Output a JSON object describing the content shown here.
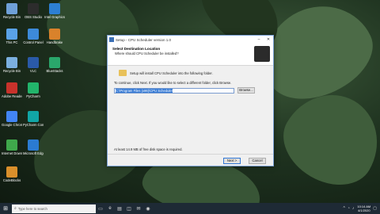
{
  "desktop_icons": [
    {
      "label": "Recycle Bin",
      "color": "#6fa0d8"
    },
    {
      "label": "OBS Studio",
      "color": "#2c2c2c"
    },
    {
      "label": "Intel Graphics",
      "color": "#2d7fd3"
    },
    {
      "label": "This PC",
      "color": "#5aa3e8"
    },
    {
      "label": "Control Panel",
      "color": "#3d8ad9"
    },
    {
      "label": "Handbrake",
      "color": "#d9822b"
    },
    {
      "label": "Recycle Bin",
      "color": "#7bb0e0"
    },
    {
      "label": "VLC",
      "color": "#2a5aa8"
    },
    {
      "label": "BlueStacks",
      "color": "#2aa76b"
    },
    {
      "label": "Adobe Reader",
      "color": "#c8322b"
    },
    {
      "label": "PyCharm",
      "color": "#22b56b"
    },
    {
      "label": "Google Chrome",
      "color": "#4285f4"
    },
    {
      "label": "PyCharm Community",
      "color": "#11a6a6"
    },
    {
      "label": "Internet Download",
      "color": "#3fa84b"
    },
    {
      "label": "Microsoft Edge",
      "color": "#2b7bd2"
    },
    {
      "label": "CodeBlocks",
      "color": "#d98f2b"
    }
  ],
  "dialog": {
    "title": "Setup - CPU Scheduler version 1.0",
    "heading": "Select Destination Location",
    "subheading": "Where should CPU Scheduler be installed?",
    "install_text": "Setup will install CPU Scheduler into the following folder.",
    "continue_text": "To continue, click Next. If you would like to select a different folder, click Browse.",
    "path_value": "C:\\Program Files (x86)\\CPU Scheduler",
    "browse_label": "Browse...",
    "space_text": "At least 14.9 MB of free disk space is required.",
    "next_label": "Next >",
    "cancel_label": "Cancel"
  },
  "taskbar": {
    "search_placeholder": "Type here to search",
    "time": "10:14 AM",
    "date": "4/1/2020"
  }
}
